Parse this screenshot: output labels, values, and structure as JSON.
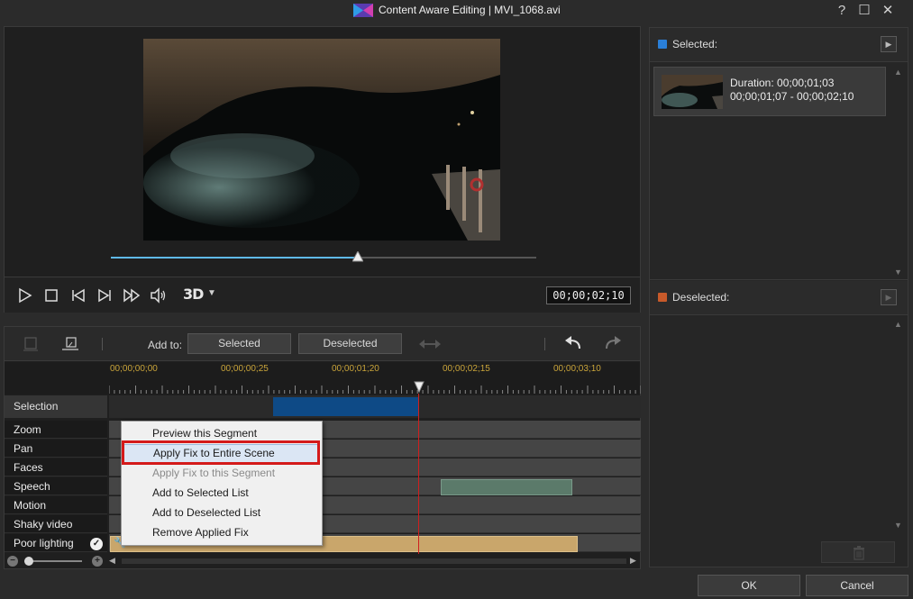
{
  "window": {
    "title": "Content Aware Editing  |  MVI_1068.avi",
    "help": "?",
    "maximize": "☐",
    "close": "✕"
  },
  "player": {
    "progress": 0.58,
    "timecode": "00;00;02;10",
    "mode_3d_label": "3D"
  },
  "selected_panel": {
    "label": "Selected:",
    "color": "#2a7fd8",
    "clips": [
      {
        "duration": "Duration: 00;00;01;03",
        "range": "00;00;01;07 - 00;00;02;10"
      }
    ]
  },
  "deselected_panel": {
    "label": "Deselected:",
    "color": "#c85a2a"
  },
  "timeline_toolbar": {
    "add_to_label": "Add to:",
    "selected_button": "Selected",
    "deselected_button": "Deselected"
  },
  "ruler": {
    "ticks": [
      "00;00;00;00",
      "00;00;00;25",
      "00;00;01;20",
      "00;00;02;15",
      "00;00;03;10"
    ]
  },
  "tracks": {
    "selection": "Selection",
    "rows": [
      "Zoom",
      "Pan",
      "Faces",
      "Speech",
      "Motion",
      "Shaky video",
      "Poor lighting"
    ]
  },
  "context_menu": {
    "items": [
      {
        "label": "Preview this Segment",
        "state": "normal"
      },
      {
        "label": "Apply Fix to Entire Scene",
        "state": "hover"
      },
      {
        "label": "Apply Fix to this Segment",
        "state": "disabled"
      },
      {
        "label": "Add to Selected List",
        "state": "normal"
      },
      {
        "label": "Add to Deselected List",
        "state": "normal"
      },
      {
        "label": "Remove Applied Fix",
        "state": "normal"
      }
    ]
  },
  "footer": {
    "ok": "OK",
    "cancel": "Cancel"
  }
}
